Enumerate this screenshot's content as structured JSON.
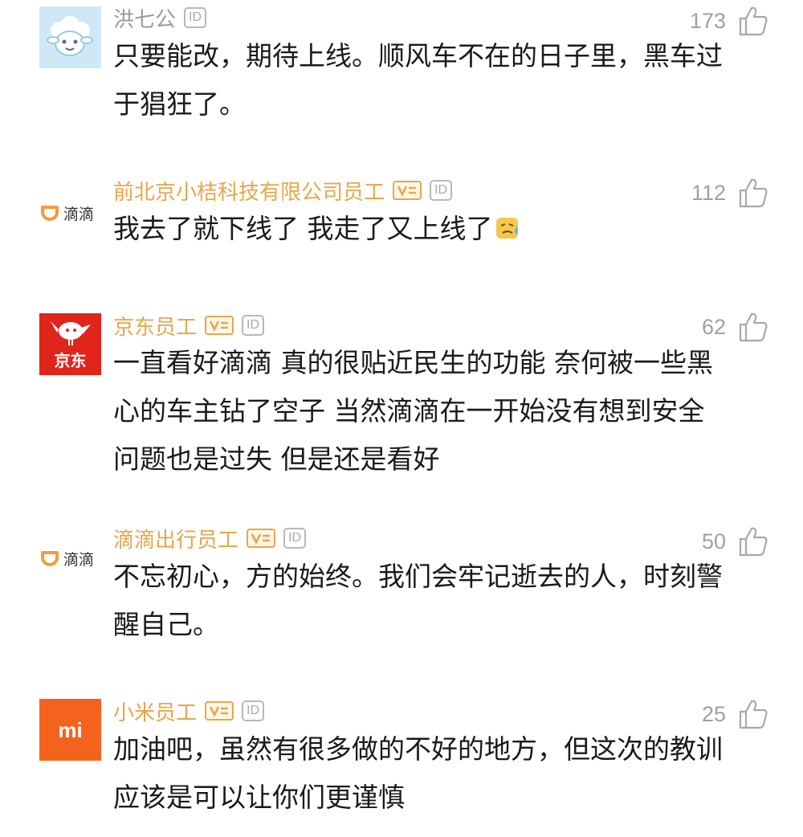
{
  "comments": [
    {
      "author": "洪七公",
      "id_badge": "ID",
      "likes": "173",
      "text": "只要能改，期待上线。顺风车不在的日子里，黑车过于猖狂了。",
      "avatar": "sheep-avatar"
    },
    {
      "author": "前北京小桔科技有限公司员工",
      "id_badge": "ID",
      "likes": "112",
      "text": "我去了就下线了 我走了又上线了",
      "org_logo_text": "滴滴",
      "emoji": "sweat-emoji"
    },
    {
      "author": "京东员工",
      "id_badge": "ID",
      "likes": "62",
      "text": "一直看好滴滴 真的很贴近民生的功能 奈何被一些黑心的车主钻了空子 当然滴滴在一开始没有想到安全问题也是过失 但是还是看好",
      "avatar_text": "京东"
    },
    {
      "author": "滴滴出行员工",
      "id_badge": "ID",
      "likes": "50",
      "text": "不忘初心，方的始终。我们会牢记逝去的人，时刻警醒自己。",
      "org_logo_text": "滴滴"
    },
    {
      "author": "小米员工",
      "id_badge": "ID",
      "likes": "25",
      "text": "加油吧，虽然有很多做的不好的地方，但这次的教训应该是可以让你们更谨慎",
      "avatar_text": "mi"
    }
  ],
  "colors": {
    "author_gray": "#9a9a9a",
    "author_verified": "#e8a64a",
    "jd_red": "#e1251b",
    "mi_orange": "#f4631e",
    "didi_orange": "#f39c3a"
  }
}
